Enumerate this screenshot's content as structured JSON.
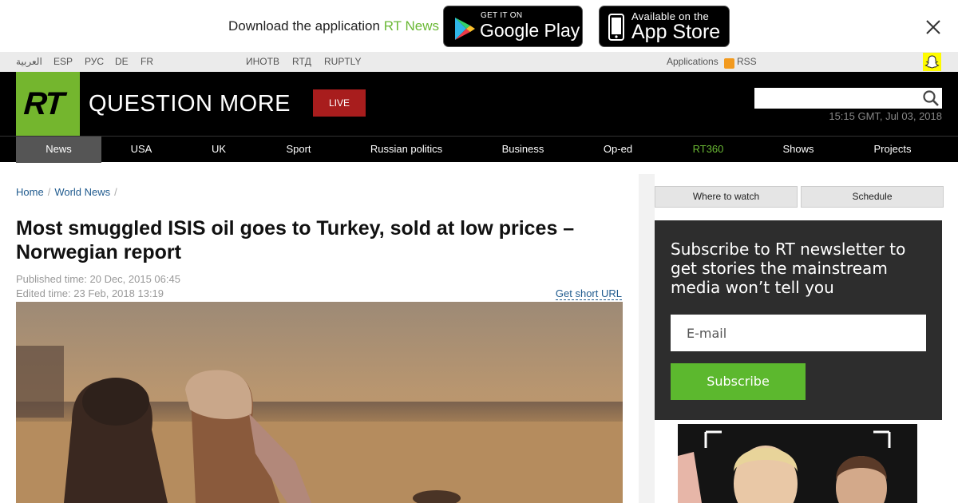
{
  "app_banner": {
    "promo_text": "Download the application ",
    "brand": "RT News",
    "google_play": {
      "small": "GET IT ON",
      "big": "Google Play"
    },
    "app_store": {
      "small": "Available on the",
      "big": "App Store"
    }
  },
  "topbar": {
    "languages": [
      "العربية",
      "ESP",
      "РУС",
      "DE",
      "FR"
    ],
    "partners": [
      "ИНОТВ",
      "RTД",
      "RUPTLY"
    ],
    "applications": "Applications",
    "rss": "RSS"
  },
  "header": {
    "logo": "RT",
    "tagline": "QUESTION MORE",
    "live": "LIVE",
    "time": "15:15 GMT, Jul 03, 2018"
  },
  "nav": [
    {
      "label": "News"
    },
    {
      "label": "USA"
    },
    {
      "label": "UK"
    },
    {
      "label": "Sport"
    },
    {
      "label": "Russian politics"
    },
    {
      "label": "Business"
    },
    {
      "label": "Op-ed"
    },
    {
      "label": "RT360"
    },
    {
      "label": "Shows"
    },
    {
      "label": "Projects"
    }
  ],
  "nav_active": "News",
  "nav_highlight": "RT360",
  "breadcrumb": [
    "Home",
    "World News"
  ],
  "article": {
    "headline": "Most smuggled ISIS oil goes to Turkey, sold at low prices – Norwegian report",
    "published": "Published time: 20 Dec, 2015 06:45",
    "edited": "Edited time: 23 Feb, 2018 13:19",
    "short_url": "Get short URL"
  },
  "sidebar": {
    "where_to_watch": "Where to watch",
    "schedule": "Schedule",
    "newsletter_title": "Subscribe to RT newsletter to get stories the mainstream media won’t tell you",
    "email_placeholder": "E-mail",
    "subscribe": "Subscribe"
  },
  "colors": {
    "accent": "#74b62e",
    "live": "#a81d1d",
    "link": "#1f5a8e",
    "subscribe": "#5cb82e"
  }
}
